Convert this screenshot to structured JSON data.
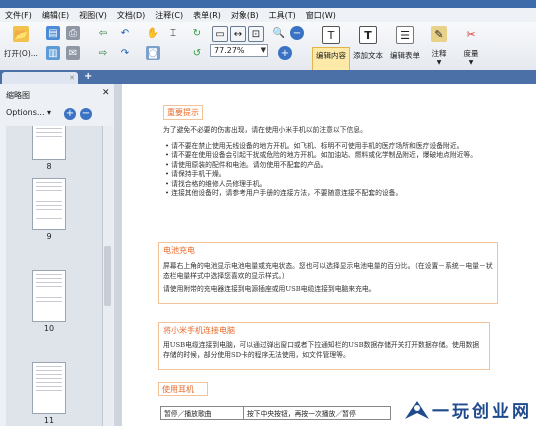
{
  "menu": [
    "文件(F)",
    "编辑(E)",
    "视图(V)",
    "文档(D)",
    "注释(C)",
    "表单(R)",
    "对象(B)",
    "工具(T)",
    "窗口(W)"
  ],
  "toolbar": {
    "open_label": "打开(O)...",
    "zoom_value": "77.27%",
    "edit_content_label": "编辑内容",
    "add_text_label": "添加文本",
    "edit_form_label": "编辑表单",
    "annotate_label": "注释",
    "measure_label": "度量"
  },
  "colors": {
    "accent": "#e86b2c",
    "highlight": "#fde9a8",
    "arrow": "#d9342b",
    "watermark": "#1f4a8c"
  },
  "tabs": {
    "doc_tab": "",
    "add_tab": "+"
  },
  "sidebar": {
    "title": "缩略图",
    "options_label": "Options...",
    "zoom_in": "+",
    "zoom_out": "−",
    "pages": [
      "8",
      "9",
      "10",
      "11"
    ]
  },
  "document": {
    "s1_title": "重要提示",
    "s1_intro": "为了避免不必要的伤害出现，请在使用小米手机以前注意以下信息。",
    "s1_bullets": [
      "请不要在禁止使用无线设备的地方开机。如飞机、标明不可使用手机的医疗场所和医疗设备附近。",
      "请不要在使用设备会引起干扰或危险的地方开机。如加油站、燃料或化学制品附近，爆破地点附近等。",
      "请使用原装的配件和电池。请勿使用不配套的产品。",
      "请保持手机干燥。",
      "请找合格的维修人员修理手机。",
      "连接其他设备时，请参考用户手册的连接方法，不要随意连接不配套的设备。"
    ],
    "s2_title": "电池充电",
    "s2_p1": "屏幕右上角的电池显示电池电量或充电状态。您也可以选择显示电池电量的百分比。（在设置－系统－电量－状态栏电量样式中选择您喜欢的显示样式。）",
    "s2_p2": "请使用附带的充电器连接到电源插座或用USB电缆连接到电脑来充电。",
    "s3_title": "将小米手机连接电脑",
    "s3_p1": "用USB电缆连接到电脑，可以通过弹出窗口或者下拉通知栏的USB数据存储开关打开数据存储。使用数据存储的时候，部分使用SD卡的程序无法使用，如文件管理等。",
    "s4_title": "使用耳机",
    "table_c1": "暂停／播放歌曲",
    "table_c2": "按下中央按钮，再按一次播放／暂停"
  },
  "watermark": "一玩创业网"
}
